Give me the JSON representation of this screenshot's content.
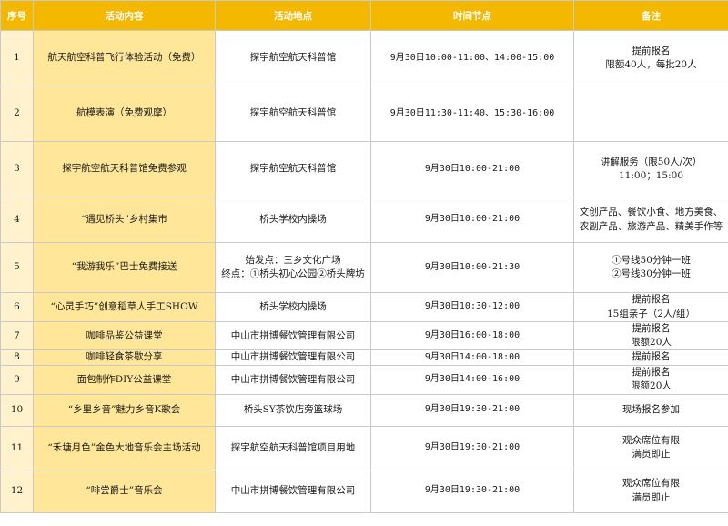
{
  "headers": [
    "序号",
    "活动内容",
    "活动地点",
    "时间节点",
    "备注"
  ],
  "rows": [
    {
      "no": "1",
      "activity": "航天航空科普飞行体验活动（免费）",
      "location": [
        "探宇航空航天科普馆"
      ],
      "time": "9月30日10:00-11:00、14:00-15:00",
      "note": [
        "提前报名",
        "限额40人，每批20人"
      ]
    },
    {
      "no": "2",
      "activity": "航模表演（免费观摩）",
      "location": [
        "探宇航空航天科普馆"
      ],
      "time": "9月30日11:30-11:40、15:30-16:00",
      "note": []
    },
    {
      "no": "3",
      "activity": "探宇航空航天科普馆免费参观",
      "location": [
        "探宇航空航天科普馆"
      ],
      "time": "9月30日10:00-21:00",
      "note": [
        "讲解服务（限50人/次）",
        "11:00；15:00"
      ]
    },
    {
      "no": "4",
      "activity": "“遇见桥头”乡村集市",
      "location": [
        "桥头学校内操场"
      ],
      "time": "9月30日10:00-21:00",
      "note": [
        "文创产品、餐饮小食、地方美食、",
        "农副产品、旅游产品、精美手作等"
      ]
    },
    {
      "no": "5",
      "activity": "“我游我乐”巴士免费接送",
      "location": [
        "始发点：三乡文化广场",
        "终点：①桥头初心公园②桥头牌坊"
      ],
      "time": "9月30日10:00-21:30",
      "note": [
        "①号线50分钟一班",
        "②号线30分钟一班"
      ]
    },
    {
      "no": "6",
      "activity": "“心灵手巧”创意稻草人手工SHOW",
      "location": [
        "桥头学校内操场"
      ],
      "time": "9月30日10:30-12:00",
      "note": [
        "提前报名",
        "15组亲子（2人/组）"
      ]
    },
    {
      "no": "7",
      "activity": "咖啡品鉴公益课堂",
      "location": [
        "中山市拼博餐饮管理有限公司"
      ],
      "time": "9月30日16:00-18:00",
      "note": [
        "提前报名",
        "限额20人"
      ]
    },
    {
      "no": "8",
      "activity": "咖啡轻食茶歇分享",
      "location": [
        "中山市拼博餐饮管理有限公司"
      ],
      "time": "9月30日14:00-18:00",
      "note": [
        "提前报名"
      ]
    },
    {
      "no": "9",
      "activity": "面包制作DIY公益课堂",
      "location": [
        "中山市拼博餐饮管理有限公司"
      ],
      "time": "9月30日14:00-16:00",
      "note": [
        "提前报名",
        "限额20人"
      ]
    },
    {
      "no": "10",
      "activity": "“乡里乡音”魅力乡音K歌会",
      "location": [
        "桥头SY茶饮店旁篮球场"
      ],
      "time": "9月30日19:30-21:00",
      "note": [
        "现场报名参加"
      ]
    },
    {
      "no": "11",
      "activity": "“禾塘月色”金色大地音乐会主场活动",
      "location": [
        "探宇航空航天科普馆项目用地"
      ],
      "time": "9月30日19:30-21:00",
      "note": [
        "观众席位有限",
        "满员即止"
      ]
    },
    {
      "no": "12",
      "activity": "“啡尝爵士”音乐会",
      "location": [
        "中山市拼博餐饮管理有限公司"
      ],
      "time": "9月30日19:30-21:00",
      "note": [
        "观众席位有限",
        "满员即止"
      ]
    }
  ]
}
